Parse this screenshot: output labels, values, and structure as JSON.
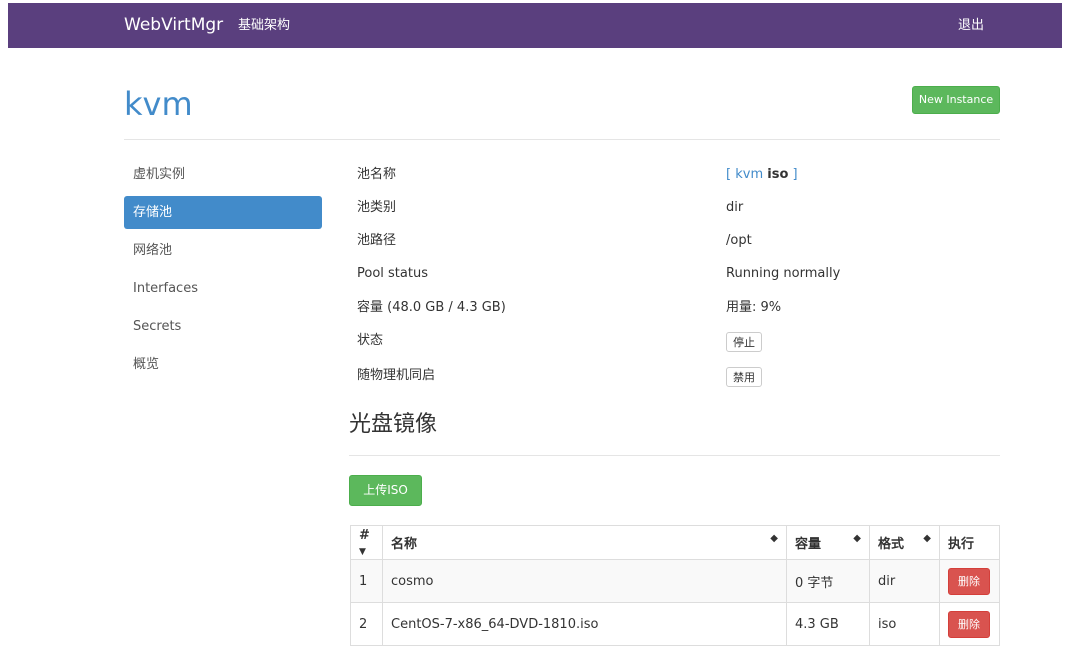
{
  "nav": {
    "brand": "WebVirtMgr",
    "infrastructure": "基础架构",
    "logout": "退出"
  },
  "page": {
    "title": "kvm",
    "new_instance": "New Instance"
  },
  "sidebar": {
    "items": [
      {
        "label": "虚机实例"
      },
      {
        "label": "存储池"
      },
      {
        "label": "网络池"
      },
      {
        "label": "Interfaces"
      },
      {
        "label": "Secrets"
      },
      {
        "label": "概览"
      }
    ]
  },
  "pool": {
    "name_label": "池名称",
    "name_open": "[ ",
    "name_link": "kvm",
    "name_current": "iso",
    "name_close": " ]",
    "type_label": "池类别",
    "type_value": "dir",
    "path_label": "池路径",
    "path_value": "/opt",
    "status_label": "Pool status",
    "status_value": "Running normally",
    "capacity_label": "容量 (48.0 GB / 4.3 GB)",
    "usage_value": "用量: 9%",
    "state_label": "状态",
    "stop_button": "停止",
    "autostart_label": "随物理机同启",
    "disable_button": "禁用"
  },
  "iso_section": {
    "title": "光盘镜像",
    "upload_button": "上传ISO"
  },
  "table": {
    "headers": {
      "index": "#",
      "name": "名称",
      "size": "容量",
      "format": "格式",
      "action": "执行"
    },
    "rows": [
      {
        "index": "1",
        "name": "cosmo",
        "size": "0 字节",
        "format": "dir",
        "action": "删除"
      },
      {
        "index": "2",
        "name": "CentOS-7-x86_64-DVD-1810.iso",
        "size": "4.3 GB",
        "format": "iso",
        "action": "删除"
      }
    ]
  }
}
